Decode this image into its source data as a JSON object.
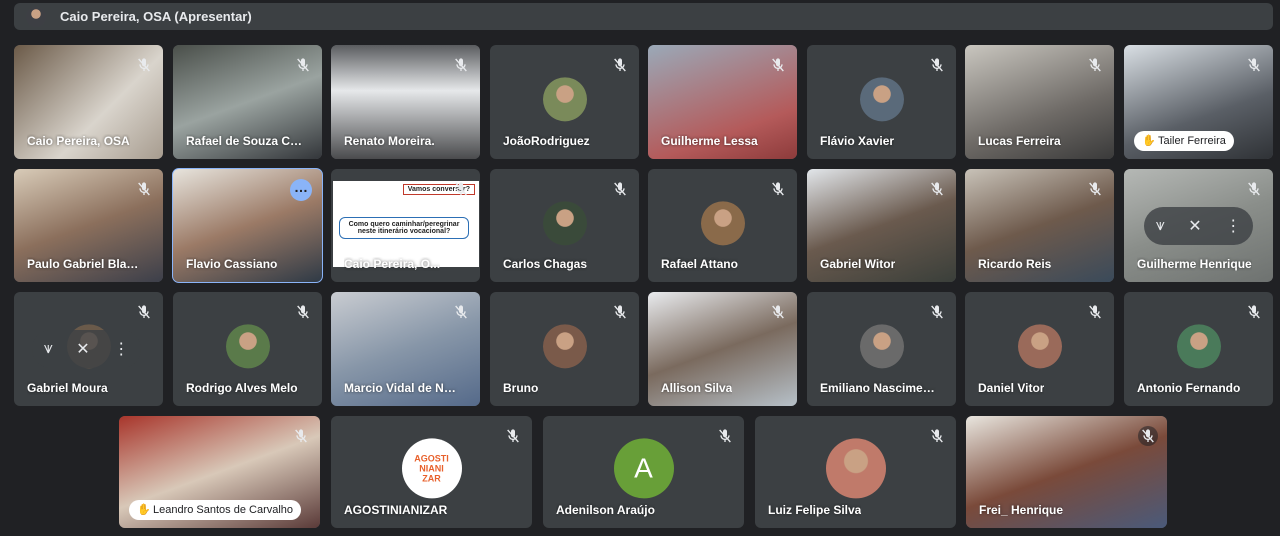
{
  "topbar": {
    "title": "Caio Pereira, OSA (Apresentar)"
  },
  "participants": [
    {
      "name": "Caio Pereira, OSA",
      "style": "video"
    },
    {
      "name": "Rafael de Souza Ca...",
      "style": "video"
    },
    {
      "name": "Renato Moreira.",
      "style": "video"
    },
    {
      "name": "JoãoRodriguez",
      "style": "avatar"
    },
    {
      "name": "Guilherme Lessa",
      "style": "video"
    },
    {
      "name": "Flávio Xavier",
      "style": "avatar"
    },
    {
      "name": "Lucas Ferreira",
      "style": "video"
    },
    {
      "name": "Tailer Ferreira",
      "style": "video"
    },
    {
      "name": "Paulo Gabriel Blanco",
      "style": "video"
    },
    {
      "name": "Flavio Cassiano",
      "style": "video"
    },
    {
      "name": "Caio Pereira, O...",
      "style": "presentation"
    },
    {
      "name": "Carlos Chagas",
      "style": "avatar"
    },
    {
      "name": "Rafael Attano",
      "style": "avatar"
    },
    {
      "name": "Gabriel Witor",
      "style": "video"
    },
    {
      "name": "Ricardo Reis",
      "style": "video"
    },
    {
      "name": "Guilherme Henrique",
      "style": "video"
    },
    {
      "name": "Gabriel Moura",
      "style": "avatar"
    },
    {
      "name": "Rodrigo Alves Melo",
      "style": "avatar"
    },
    {
      "name": "Marcio Vidal de Neg...",
      "style": "video"
    },
    {
      "name": "Bruno",
      "style": "avatar"
    },
    {
      "name": "Allison Silva",
      "style": "video"
    },
    {
      "name": "Emiliano Nascimento",
      "style": "avatar"
    },
    {
      "name": "Daniel Vitor",
      "style": "avatar"
    },
    {
      "name": "Antonio Fernando",
      "style": "avatar"
    },
    {
      "name": "Leandro Santos de Carvalho",
      "style": "video"
    },
    {
      "name": "AGOSTINIANIZAR",
      "style": "logo"
    },
    {
      "name": "Adenilson Araújo",
      "style": "letter"
    },
    {
      "name": "Luiz Felipe Silva",
      "style": "avatar"
    },
    {
      "name": "Frei_ Henrique",
      "style": "video"
    }
  ],
  "slide": {
    "question1": "Vamos conversar?",
    "question2": "Como quero caminhar/peregrinar neste itinerário vocacional?"
  },
  "logo": {
    "line1": "AGOSTI",
    "line2": "NIANI",
    "line3": "ZAR"
  },
  "letter_avatar": {
    "letter": "A",
    "color": "#689f38"
  },
  "colors": {
    "background": "#202124",
    "tile": "#3c4043",
    "active_border": "#8ab4f8"
  }
}
